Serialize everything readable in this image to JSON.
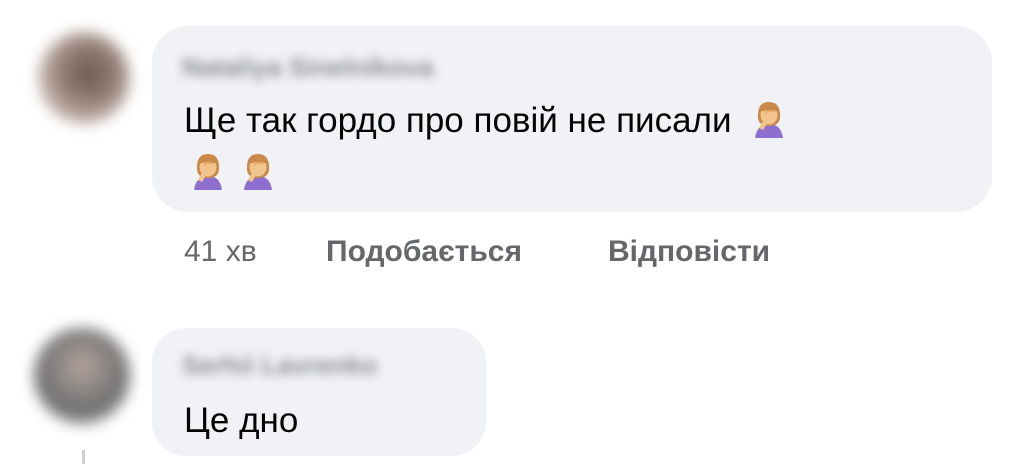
{
  "comments": [
    {
      "author": "Nataliya Sinelnikova",
      "text": "Ще так гордо про повій не писали",
      "emojis": [
        "woman-facepalming-icon",
        "woman-facepalming-icon",
        "woman-facepalming-icon"
      ],
      "time": "41 хв",
      "like_label": "Подобається",
      "reply_label": "Відповісти"
    },
    {
      "author": "Serhii Lavrenko",
      "text": "Це дно"
    }
  ],
  "colors": {
    "bubble": "#f0f2f5",
    "text": "#050505",
    "meta": "#65676b"
  }
}
